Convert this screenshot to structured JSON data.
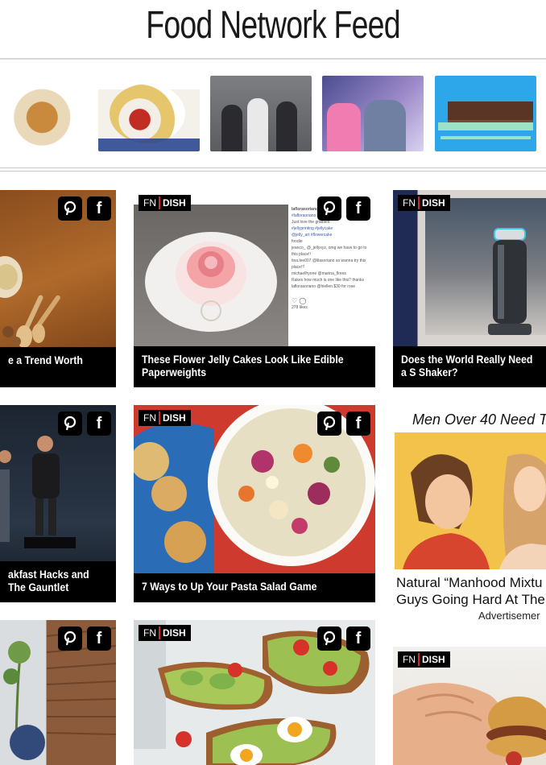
{
  "header": {
    "title": "Food Network Feed"
  },
  "thumbnails": [
    {
      "subject": "chicken-plate"
    },
    {
      "subject": "spaghetti-plate"
    },
    {
      "subject": "chefs-group"
    },
    {
      "subject": "judges-panel"
    },
    {
      "subject": "brownie-cake"
    }
  ],
  "social": {
    "pinterest_glyph": "P",
    "facebook_glyph": "f"
  },
  "badge": {
    "fn": "FN",
    "dish": "DISH"
  },
  "cards": {
    "trend": {
      "caption": "e a Trend Worth"
    },
    "flower_jelly": {
      "caption": "These Flower Jelly Cakes Look Like Edible Paperweights",
      "post_lines": [
        "laflorasoriano",
        "#lafloraoriano",
        "Just love the gradient",
        "#jellyprinting #jellycake",
        "@jelly_art #flowercake",
        "foodie",
        "jeanco_ @_jellyxyz, omg we have to go to this place!!",
        "tina.lee007 @lilasoriano so wanna try this place!!!",
        "michaelfryone @marina_flores",
        "Rakes how much is one like this? thanks",
        "laflorasoriano @hiellen $30 for rose"
      ],
      "likes": "278 likes"
    },
    "salt_shaker": {
      "caption": "Does the World Really Need a S Shaker?"
    },
    "breakfast": {
      "caption": "akfast Hacks and The Gauntlet"
    },
    "pasta": {
      "caption": "7 Ways to Up Your Pasta Salad Game"
    },
    "terrace": {},
    "avocado": {},
    "burger": {}
  },
  "ad": {
    "headline": "Men Over 40 Need T",
    "body_line1": "Natural “Manhood Mixtu",
    "body_line2": "Guys Going Hard At The",
    "label": "Advertisemer"
  }
}
